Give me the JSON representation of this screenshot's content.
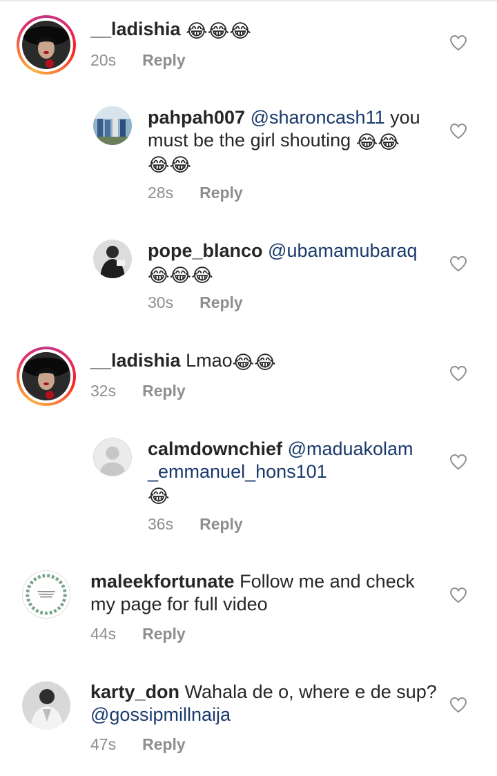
{
  "comments": [
    {
      "username": "__ladishia",
      "mention": "",
      "text": "",
      "emoji": "😂😂😂",
      "time": "20s",
      "reply": "Reply"
    },
    {
      "username": "pahpah007",
      "mention": "@sharoncash11",
      "text": "you must be the girl shouting",
      "emoji": "😂😂",
      "emoji2": "😂😂",
      "time": "28s",
      "reply": "Reply"
    },
    {
      "username": "pope_blanco",
      "mention": "@ubamamubaraq",
      "text": "",
      "emoji": "😂😂😂",
      "time": "30s",
      "reply": "Reply"
    },
    {
      "username": "__ladishia",
      "mention": "",
      "text": "Lmao",
      "emoji": "😂😂",
      "time": "32s",
      "reply": "Reply"
    },
    {
      "username": "calmdownchief",
      "mention": "@maduakolam",
      "mention2": "_emmanuel_hons101",
      "text": "",
      "emoji": "😂",
      "time": "36s",
      "reply": "Reply"
    },
    {
      "username": "maleekfortunate",
      "mention": "",
      "text": "Follow me and check",
      "text2": "my page for full video",
      "emoji": "",
      "time": "44s",
      "reply": "Reply"
    },
    {
      "username": "karty_don",
      "mention": "",
      "text": "Wahala de o, where e de sup?",
      "mention2": "@gossipmillnaija",
      "emoji": "",
      "time": "47s",
      "reply": "Reply"
    }
  ],
  "icons": {
    "heart": "heart-outline-icon"
  },
  "colors": {
    "mention": "#1a3a6b",
    "meta": "#8e8e8e",
    "text": "#262626"
  }
}
